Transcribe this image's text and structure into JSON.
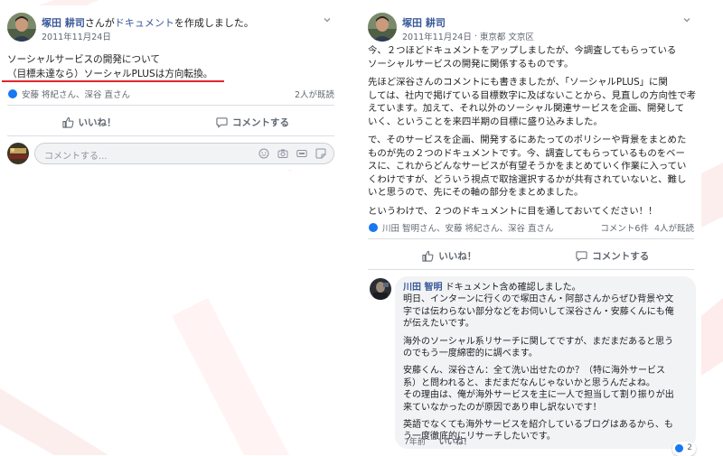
{
  "left_post": {
    "author": "塚田 耕司",
    "action_text": "さんが",
    "doc_link": "ドキュメント",
    "action_suffix": "を作成しました。",
    "date": "2011年11月24日",
    "body": [
      "ソーシャルサービスの開発について",
      "（目標未達なら）ソーシャルPLUSは方向転換。"
    ],
    "reactors": "安藤 将紀さん、深谷 直さん",
    "seen": "2人が既読",
    "like_label": "いいね！",
    "comment_label": "コメントする",
    "comment_placeholder": "コメントする...",
    "underline_color": "#e0262d"
  },
  "right_post": {
    "author": "塚田 耕司",
    "date": "2011年11月24日",
    "location": "東京都 文京区",
    "body": [
      [
        "今、２つほどドキュメントをアップしましたが、今調査してもらっている",
        "ソーシャルサービスの開発に関係するものです。"
      ],
      [
        "先ほど深谷さんのコメントにも書きましたが、「ソーシャルPLUS」に関",
        "しては、社内で掲げている目標数字に及ばないことから、見直しの方向性で考",
        "えています。加えて、それ以外のソーシャル関連サービスを企画、開発して",
        "いく、ということを来四半期の目標に盛り込みました。"
      ],
      [
        "で、そのサービスを企画、開発するにあたってのポリシーや背景をまとめた",
        "ものが先の２つのドキュメントです。今、調査してもらっているものをベー",
        "スに、これからどんなサービスが有望そうかをまとめていく作業に入ってい",
        "くわけですが、どういう視点で取捨選択するかが共有されていないと、難し",
        "いと思うので、先にその軸の部分をまとめました。"
      ],
      [
        "というわけで、２つのドキュメントに目を通しておいてください！！"
      ]
    ],
    "reactors": "川田 智明さん、安藤 将紀さん、深谷 直さん",
    "comment_count": "コメント6件",
    "seen": "4人が既読",
    "like_label": "いいね！",
    "comment_label": "コメントする",
    "comment": {
      "author": "川田 智明",
      "first_line": "ドキュメント含め確認しました。",
      "paragraphs": [
        [
          "明日、インターンに行くので塚田さん・阿部さんからぜひ背景や文",
          "字では伝わらない部分などをお伺いして深谷さん・安藤くんにも俺",
          "が伝えたいです。"
        ],
        [
          "海外のソーシャル系リサーチに関してですが、まだまだあると思う",
          "のでもう一度綿密的に調べます。"
        ],
        [
          "安藤くん、深谷さん：全て洗い出せたのか？（特に海外サービス",
          "系）と問われると、まだまだなんじゃないかと思うんだよね。",
          "その理由は、俺が海外サービスを主に一人で担当して割り振りが出",
          "来ていなかったのが原因であり申し訳ないです！"
        ],
        [
          "英語でなくても海外サービスを紹介しているブログはあるから、も",
          "う一度徹底的にリサーチしたいです。"
        ]
      ],
      "reaction_count": "2",
      "time": "7年前",
      "like_label": "いいね！"
    }
  },
  "colors": {
    "link": "#385898",
    "like_blue": "#1877f2",
    "love_red": "#f0284a"
  }
}
